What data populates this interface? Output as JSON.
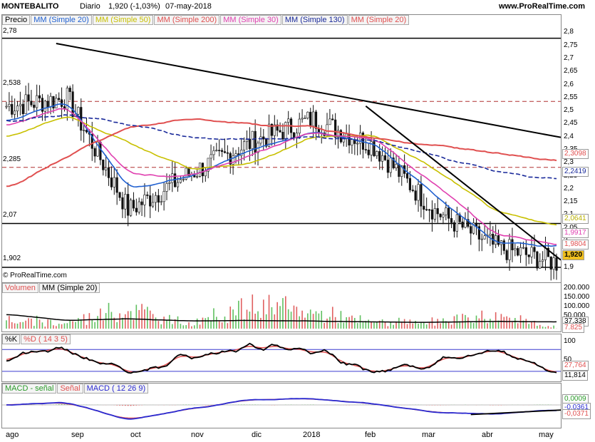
{
  "header": {
    "symbol": "MONTEBALITO",
    "period": "Diario",
    "quote": "1,920 (-1,03%)",
    "date": "07-may-2018",
    "site": "www.ProRealTime.com",
    "copyright": "© ProRealTime.com"
  },
  "price_panel": {
    "legend": [
      "Precio",
      "MM (Simple 20)",
      "MM (Simple 50)",
      "MM (Simple 200)",
      "MM (Simple 30)",
      "MM (Simple 130)",
      "MM (Simple 20)"
    ],
    "levels": [
      "2,78",
      "2,538",
      "2,285",
      "2,07",
      "1,902"
    ],
    "ticks": [
      "2,8",
      "2,75",
      "2,7",
      "2,65",
      "2,6",
      "2,55",
      "2,5",
      "2,45",
      "2,4",
      "2,35",
      "2,3",
      "2,25",
      "2,2",
      "2,15",
      "2,1",
      "2,05",
      "2",
      "1,95",
      "1,9"
    ],
    "badges": [
      {
        "text": "2,3098",
        "color": "#e05050"
      },
      {
        "text": "2,2419",
        "color": "#1a2a9a"
      },
      {
        "text": "2,0641",
        "color": "#b8b000"
      },
      {
        "text": "1,9917",
        "color": "#e040b0"
      },
      {
        "text": "1,9804",
        "color": "#e05050"
      },
      {
        "text": "1,920",
        "color": "#000000",
        "bg": "#f0c020"
      }
    ]
  },
  "volume_panel": {
    "legend": [
      "Volumen",
      "MM (Simple 20)"
    ],
    "ticks": [
      "200.000",
      "150.000",
      "100.000",
      "50.000"
    ],
    "badges": [
      {
        "text": "37.338",
        "color": "#000"
      },
      {
        "text": "7.825",
        "color": "#e05050"
      }
    ]
  },
  "stoch_panel": {
    "legend": [
      "%K",
      "%D ( 14 3 5)"
    ],
    "ticks": [
      "100",
      "50"
    ],
    "badges": [
      {
        "text": "27,764",
        "color": "#e05050"
      },
      {
        "text": "11,814",
        "color": "#000"
      }
    ]
  },
  "macd_panel": {
    "legend": [
      "MACD - señal",
      "Señal",
      "MACD ( 12 26 9)"
    ],
    "badges": [
      {
        "text": "0,0009",
        "color": "#2a9a2a"
      },
      {
        "text": "-0,0361",
        "color": "#2a2ad0"
      },
      {
        "text": "-0,0371",
        "color": "#e05050"
      }
    ]
  },
  "x_axis": [
    "ago",
    "sep",
    "oct",
    "nov",
    "dic",
    "2018",
    "feb",
    "mar",
    "abr",
    "may"
  ],
  "chart_data": [
    {
      "type": "line",
      "title": "MONTEBALITO Diario",
      "x": [
        "ago",
        "sep",
        "oct",
        "nov",
        "dic",
        "2018",
        "feb",
        "mar",
        "abr",
        "may"
      ],
      "ylim": [
        1.88,
        2.82
      ],
      "series": [
        {
          "name": "Precio",
          "values": [
            2.52,
            2.55,
            2.12,
            2.26,
            2.38,
            2.47,
            2.37,
            2.12,
            1.98,
            1.92
          ]
        },
        {
          "name": "MM (Simple 20)",
          "values": [
            2.46,
            2.54,
            2.2,
            2.25,
            2.35,
            2.42,
            2.38,
            2.18,
            2.0,
            1.98
          ]
        },
        {
          "name": "MM (Simple 50)",
          "values": [
            2.4,
            2.48,
            2.38,
            2.28,
            2.3,
            2.4,
            2.41,
            2.28,
            2.12,
            2.064
          ]
        },
        {
          "name": "MM (Simple 200)",
          "values": [
            2.2,
            2.33,
            2.44,
            2.47,
            2.45,
            2.44,
            2.4,
            2.37,
            2.34,
            2.31
          ]
        },
        {
          "name": "MM (Simple 30)",
          "values": [
            2.44,
            2.52,
            2.26,
            2.25,
            2.33,
            2.42,
            2.4,
            2.22,
            2.03,
            1.99
          ]
        },
        {
          "name": "MM (Simple 130)",
          "values": [
            2.46,
            2.49,
            2.45,
            2.4,
            2.39,
            2.4,
            2.39,
            2.33,
            2.27,
            2.24
          ]
        }
      ],
      "levels": [
        2.78,
        2.538,
        2.285,
        2.07,
        1.902
      ]
    },
    {
      "type": "bar",
      "title": "Volumen",
      "x": [
        "ago",
        "sep",
        "oct",
        "nov",
        "dic",
        "2018",
        "feb",
        "mar",
        "abr",
        "may"
      ],
      "ylim": [
        0,
        220000
      ],
      "series": [
        {
          "name": "Volumen",
          "values": [
            60000,
            40000,
            150000,
            30000,
            170000,
            120000,
            50000,
            40000,
            90000,
            7825
          ]
        },
        {
          "name": "MM (Simple 20)",
          "values": [
            80000,
            45000,
            55000,
            42000,
            45000,
            42000,
            38000,
            35000,
            40000,
            37338
          ]
        }
      ]
    },
    {
      "type": "line",
      "title": "%K %D ( 14 3 5)",
      "x": [
        "ago",
        "sep",
        "oct",
        "nov",
        "dic",
        "2018",
        "feb",
        "mar",
        "abr",
        "may"
      ],
      "ylim": [
        0,
        110
      ],
      "series": [
        {
          "name": "%K",
          "values": [
            60,
            80,
            10,
            70,
            85,
            80,
            20,
            40,
            80,
            11.814
          ]
        },
        {
          "name": "%D ( 14 3 5)",
          "values": [
            55,
            75,
            15,
            65,
            80,
            75,
            25,
            38,
            75,
            27.764
          ]
        }
      ]
    },
    {
      "type": "line",
      "title": "MACD ( 12 26 9)",
      "x": [
        "ago",
        "sep",
        "oct",
        "nov",
        "dic",
        "2018",
        "feb",
        "mar",
        "abr",
        "may"
      ],
      "series": [
        {
          "name": "MACD",
          "values": [
            0.0,
            0.02,
            -0.12,
            -0.03,
            0.04,
            0.05,
            0.01,
            -0.06,
            -0.07,
            -0.0361
          ]
        },
        {
          "name": "Señal",
          "values": [
            0.0,
            0.01,
            -0.08,
            -0.05,
            0.02,
            0.04,
            0.02,
            -0.04,
            -0.06,
            -0.0371
          ]
        },
        {
          "name": "MACD - señal",
          "values": [
            0.0,
            0.01,
            -0.04,
            0.02,
            0.02,
            0.01,
            -0.01,
            -0.02,
            -0.01,
            0.0009
          ]
        }
      ]
    }
  ]
}
